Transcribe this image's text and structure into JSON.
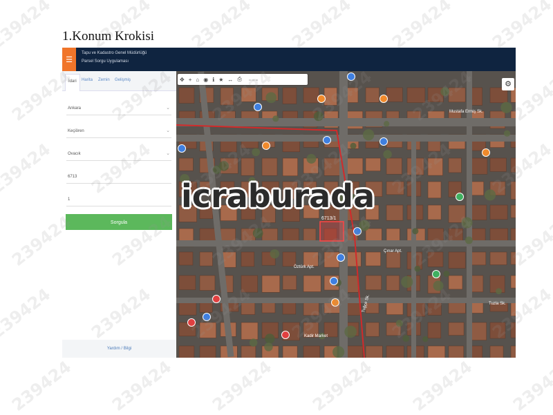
{
  "document": {
    "title": "1.Konum Krokisi"
  },
  "watermark": {
    "text": "239424"
  },
  "header": {
    "line1": "Tapu ve Kadastro Genel Müdürlüğü",
    "line2": "Parsel Sorgu Uygulaması",
    "menu_icon": "hamburger-icon",
    "bg_color": "#0f2440",
    "accent_color": "#f0752a"
  },
  "tabs": [
    {
      "label": "İdari"
    },
    {
      "label": "Harita"
    },
    {
      "label": "Zemin"
    },
    {
      "label": "Gelişmiş"
    }
  ],
  "form": {
    "province": "Ankara",
    "district": "Keçiören",
    "neighborhood": "Ovacık",
    "block": "6713",
    "parcel": "1",
    "query_label": "Sorgula"
  },
  "panel_footer": "Yardım / Bilgi",
  "map": {
    "labels": [
      {
        "text": "Mustafa Ermiş Sk."
      },
      {
        "text": "Tuğçe Sk."
      },
      {
        "text": "Tuzla Sk."
      },
      {
        "text": "Öztürk Apt."
      },
      {
        "text": "Çınar Apt."
      },
      {
        "text": "Kadir Market"
      }
    ],
    "parcel_label": "6713/1",
    "overlay_text": "icraburada",
    "colors": {
      "road": "#6f6c68",
      "roof": "#8f5b43",
      "boundary": "#d22a2a",
      "pin_blue": "#3f7fe0",
      "pin_orange": "#f08a2c",
      "pin_red": "#e04040",
      "pin_green": "#3fb060"
    }
  }
}
